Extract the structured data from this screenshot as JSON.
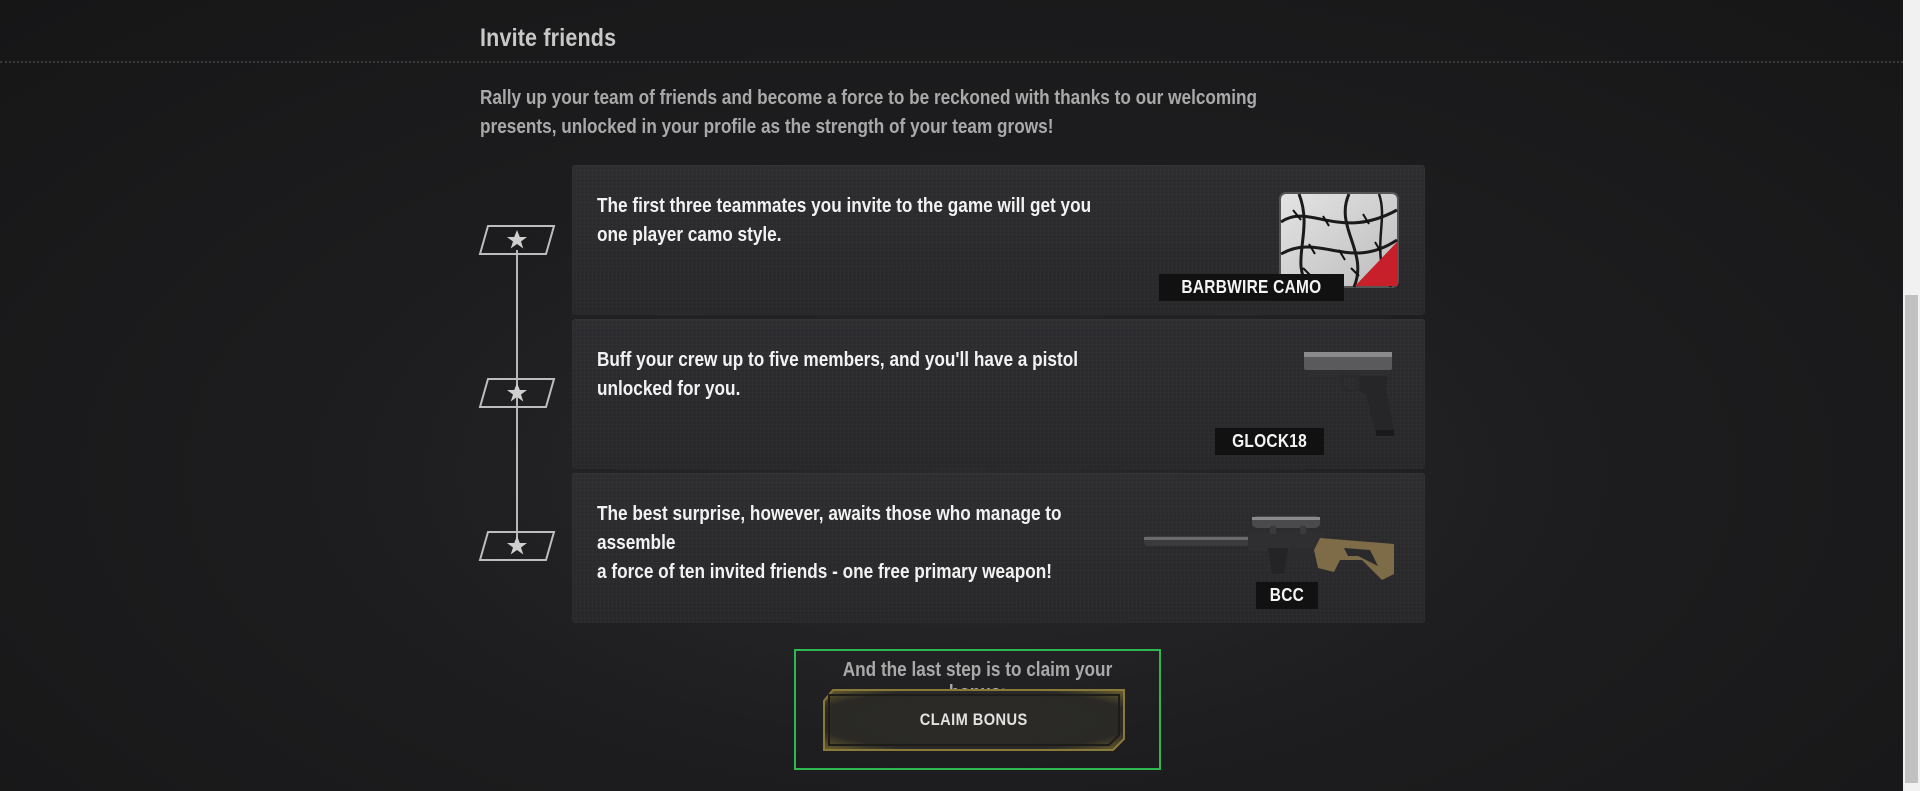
{
  "section": {
    "title": "Invite friends",
    "intro": "Rally up your team of friends and become a force to be reckoned with thanks to our welcoming presents, unlocked in your profile as the strength of your team grows!"
  },
  "rewards": [
    {
      "text": "The first three teammates you invite to the game will get you one player camo style.",
      "label": "BARBWIRE CAMO",
      "icon": "barbwire-camo-icon"
    },
    {
      "text": "Buff your crew up to five members, and you'll have a pistol unlocked for you.",
      "label": "GLOCK18",
      "icon": "pistol-icon"
    },
    {
      "text": "The best surprise, however, awaits those who manage to assemble\na force of ten invited friends - one free primary weapon!",
      "label": "BCC",
      "icon": "sniper-rifle-icon"
    }
  ],
  "claim": {
    "prompt": "And the last step is to claim your bonus:",
    "button_label": "CLAIM BONUS"
  },
  "colors": {
    "background": "#1d1d1f",
    "card": "#2b2b2e",
    "highlight_border": "#2fb84f",
    "accent_camo_red": "#c8202a",
    "button_gold": "#8a7a3a"
  }
}
